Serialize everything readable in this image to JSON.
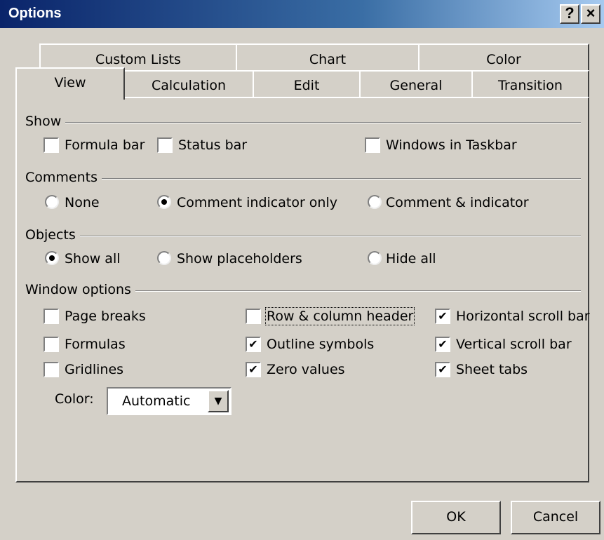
{
  "window": {
    "title": "Options",
    "help_label": "?",
    "close_label": "×"
  },
  "tabs": {
    "row1": [
      "Custom Lists",
      "Chart",
      "Color"
    ],
    "row2": [
      "View",
      "Calculation",
      "Edit",
      "General",
      "Transition"
    ],
    "active": "View"
  },
  "show": {
    "title": "Show",
    "formula_bar": {
      "label": "Formula bar",
      "checked": false
    },
    "status_bar": {
      "label": "Status bar",
      "checked": false
    },
    "windows_in_taskbar": {
      "label": "Windows in Taskbar",
      "checked": false
    }
  },
  "comments": {
    "title": "Comments",
    "options": [
      "None",
      "Comment indicator only",
      "Comment & indicator"
    ],
    "selected": "Comment indicator only"
  },
  "objects": {
    "title": "Objects",
    "options": [
      "Show all",
      "Show placeholders",
      "Hide all"
    ],
    "selected": "Show all"
  },
  "window_options": {
    "title": "Window options",
    "page_breaks": {
      "label": "Page breaks",
      "checked": false
    },
    "formulas": {
      "label": "Formulas",
      "checked": false
    },
    "gridlines": {
      "label": "Gridlines",
      "checked": false
    },
    "row_column_header": {
      "label": "Row & column header",
      "checked": false
    },
    "outline_symbols": {
      "label": "Outline symbols",
      "checked": true
    },
    "zero_values": {
      "label": "Zero values",
      "checked": true
    },
    "horizontal_scroll_bar": {
      "label": "Horizontal scroll bar",
      "checked": true
    },
    "vertical_scroll_bar": {
      "label": "Vertical scroll bar",
      "checked": true
    },
    "sheet_tabs": {
      "label": "Sheet tabs",
      "checked": true
    },
    "color_label": "Color:",
    "color_value": "Automatic"
  },
  "buttons": {
    "ok": "OK",
    "cancel": "Cancel"
  },
  "check_glyph": "✔",
  "dropdown_glyph": "▼"
}
